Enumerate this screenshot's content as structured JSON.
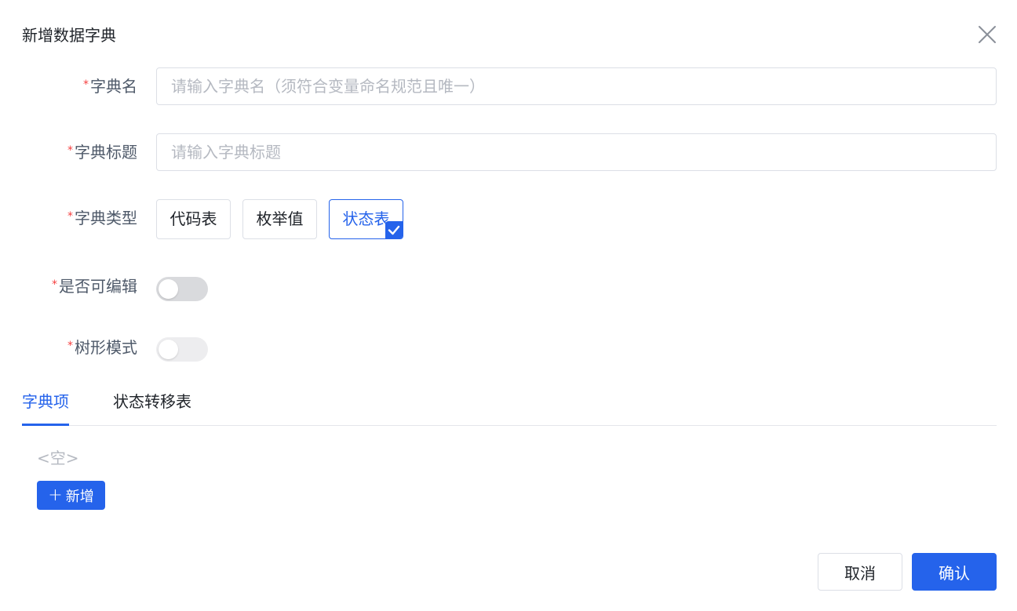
{
  "dialog": {
    "title": "新增数据字典",
    "close_icon": "close-icon"
  },
  "form": {
    "required_mark": "*",
    "name": {
      "label": "字典名",
      "value": "",
      "placeholder": "请输入字典名（须符合变量命名规范且唯一）"
    },
    "title": {
      "label": "字典标题",
      "value": "",
      "placeholder": "请输入字典标题"
    },
    "type": {
      "label": "字典类型",
      "options": [
        "代码表",
        "枚举值",
        "状态表"
      ],
      "selected": "状态表"
    },
    "editable": {
      "label": "是否可编辑",
      "on": false
    },
    "tree_mode": {
      "label": "树形模式",
      "on": false,
      "disabled": true
    }
  },
  "tabs": {
    "items": [
      "字典项",
      "状态转移表"
    ],
    "active": "字典项"
  },
  "items_panel": {
    "empty_text": "<空>",
    "add_label": "新增"
  },
  "footer": {
    "cancel_label": "取消",
    "confirm_label": "确认"
  },
  "colors": {
    "primary": "#2563eb",
    "required": "#f53f3f",
    "placeholder": "#b5b9c1"
  }
}
